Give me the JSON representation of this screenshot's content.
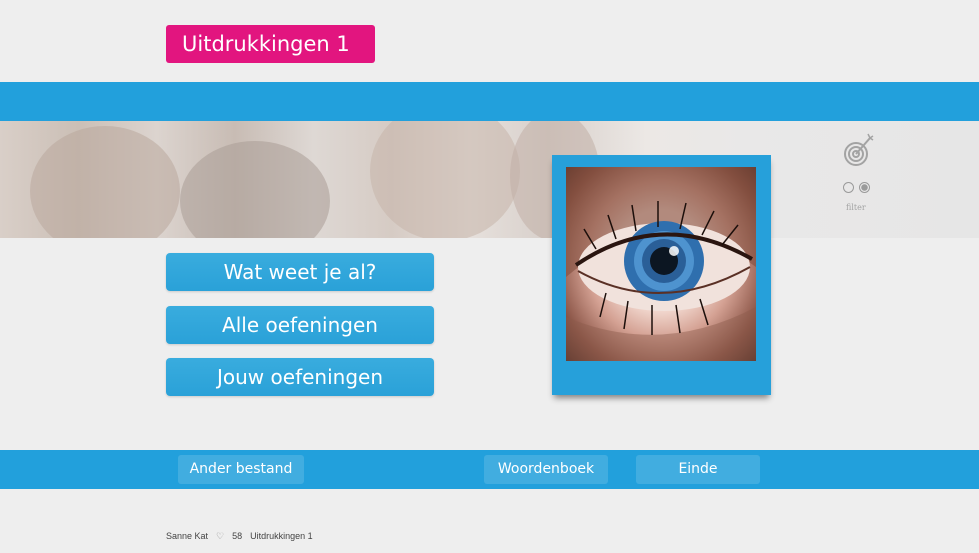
{
  "header": {
    "title": "Uitdrukkingen 1"
  },
  "side_panel": {
    "filter_label": "filter",
    "icon": "target-icon"
  },
  "menu": {
    "buttons": [
      {
        "label": "Wat weet je al?"
      },
      {
        "label": "Alle oefeningen"
      },
      {
        "label": "Jouw oefeningen"
      }
    ]
  },
  "picture": {
    "subject": "eye",
    "icon": "eye-photo"
  },
  "bottom_bar": {
    "other_file_label": "Ander bestand",
    "dictionary_label": "Woordenboek",
    "end_label": "Einde"
  },
  "footer": {
    "user_name": "Sanne Kat",
    "score": "58",
    "lesson_name": "Uitdrukkingen 1"
  },
  "colors": {
    "accent": "#22a0dc",
    "title_badge": "#e2157f",
    "background": "#eeeeee"
  }
}
